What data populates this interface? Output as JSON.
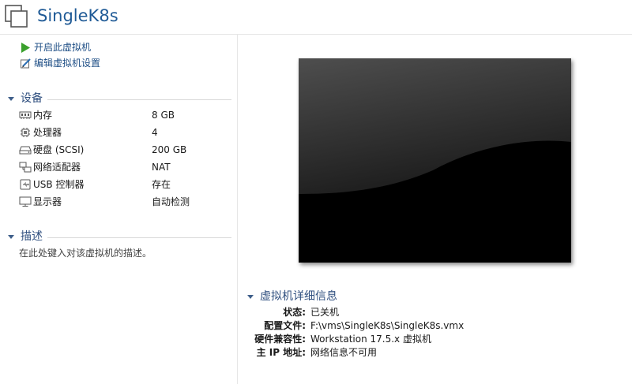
{
  "header": {
    "title": "SingleK8s"
  },
  "actions": [
    {
      "label": "开启此虚拟机",
      "icon": "play-icon"
    },
    {
      "label": "编辑虚拟机设置",
      "icon": "edit-settings-icon"
    }
  ],
  "devices": {
    "title": "设备",
    "items": [
      {
        "label": "内存",
        "value": "8 GB",
        "icon": "memory-icon"
      },
      {
        "label": "处理器",
        "value": "4",
        "icon": "cpu-icon"
      },
      {
        "label": "硬盘 (SCSI)",
        "value": "200 GB",
        "icon": "hard-disk-icon"
      },
      {
        "label": "网络适配器",
        "value": "NAT",
        "icon": "network-adapter-icon"
      },
      {
        "label": "USB 控制器",
        "value": "存在",
        "icon": "usb-icon"
      },
      {
        "label": "显示器",
        "value": "自动检测",
        "icon": "display-icon"
      }
    ]
  },
  "description": {
    "title": "描述",
    "placeholder": "在此处键入对该虚拟机的描述。"
  },
  "details": {
    "title": "虚拟机详细信息",
    "rows": [
      {
        "key": "状态:",
        "value": "已关机"
      },
      {
        "key": "配置文件:",
        "value": "F:\\vms\\SingleK8s\\SingleK8s.vmx"
      },
      {
        "key": "硬件兼容性:",
        "value": "Workstation 17.5.x 虚拟机"
      },
      {
        "key": "主 IP 地址:",
        "value": "网络信息不可用"
      }
    ]
  },
  "colors": {
    "title": "#1f5a96",
    "link": "#1f4f86",
    "section": "#2f4f7f",
    "play": "#3aa02c"
  }
}
